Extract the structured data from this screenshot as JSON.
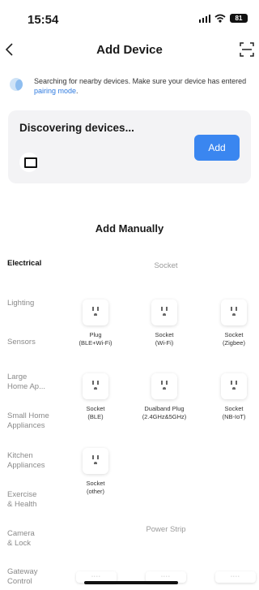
{
  "status_bar": {
    "time": "15:54",
    "battery": "81"
  },
  "nav": {
    "title": "Add Device"
  },
  "search": {
    "text": "Searching for nearby devices. Make sure your device has entered ",
    "link": "pairing mode",
    "suffix": "."
  },
  "discover": {
    "title": "Discovering devices...",
    "add_label": "Add"
  },
  "add_manually": {
    "title": "Add Manually"
  },
  "sidebar": {
    "items": [
      {
        "label": "Electrical",
        "active": true
      },
      {
        "label": "Lighting"
      },
      {
        "label": "Sensors"
      },
      {
        "label": "Large\nHome Ap..."
      },
      {
        "label": "Small Home\nAppliances"
      },
      {
        "label": "Kitchen\nAppliances"
      },
      {
        "label": "Exercise\n& Health"
      },
      {
        "label": "Camera\n& Lock"
      },
      {
        "label": "Gateway\nControl"
      }
    ]
  },
  "groups": {
    "socket": {
      "title": "Socket",
      "items": [
        {
          "label": "Plug\n(BLE+Wi-Fi)"
        },
        {
          "label": "Socket\n(Wi-Fi)"
        },
        {
          "label": "Socket\n(Zigbee)"
        },
        {
          "label": "Socket\n(BLE)"
        },
        {
          "label": "Dualband Plug\n(2.4GHz&5GHz)"
        },
        {
          "label": "Socket\n(NB-IoT)"
        },
        {
          "label": "Socket\n(other)"
        }
      ]
    },
    "power_strip": {
      "title": "Power Strip"
    }
  },
  "colors": {
    "accent": "#3a86f0",
    "link": "#2f7be0",
    "card_bg": "#f3f3f5"
  }
}
